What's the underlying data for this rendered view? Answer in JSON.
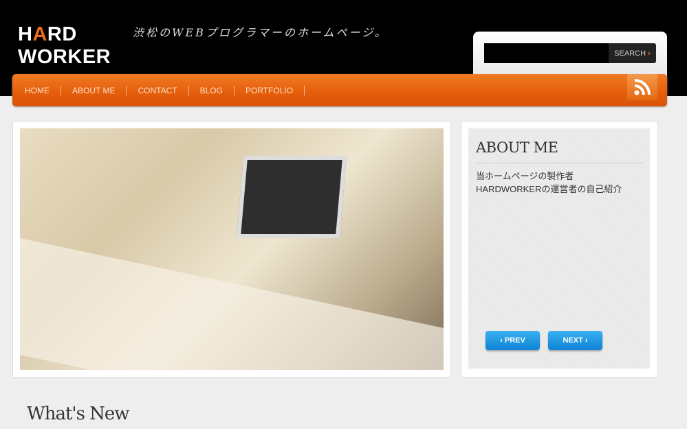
{
  "header": {
    "logo_line1_h": "H",
    "logo_line1_a": "A",
    "logo_line1_rest": "RD",
    "logo_line2": "WORKER",
    "tagline": "渋松のWEBプログラマーのホームページ。"
  },
  "search": {
    "value": "",
    "button_label": "SEARCH",
    "button_arrow": "›"
  },
  "nav": {
    "items": [
      {
        "label": "HOME"
      },
      {
        "label": "ABOUT ME"
      },
      {
        "label": "CONTACT"
      },
      {
        "label": "BLOG"
      },
      {
        "label": "PORTFOLIO"
      }
    ],
    "rss_icon": "rss-icon"
  },
  "colors": {
    "accent": "#e35d0b",
    "button_blue": "#1a8fe0"
  },
  "about": {
    "title": "ABOUT ME",
    "line1": "当ホームページの製作者",
    "line2": "HARDWORKERの運営者の自己紹介",
    "prev_label": "‹  PREV",
    "next_label": "NEXT  ›"
  },
  "main": {
    "section_title": "What's New"
  }
}
